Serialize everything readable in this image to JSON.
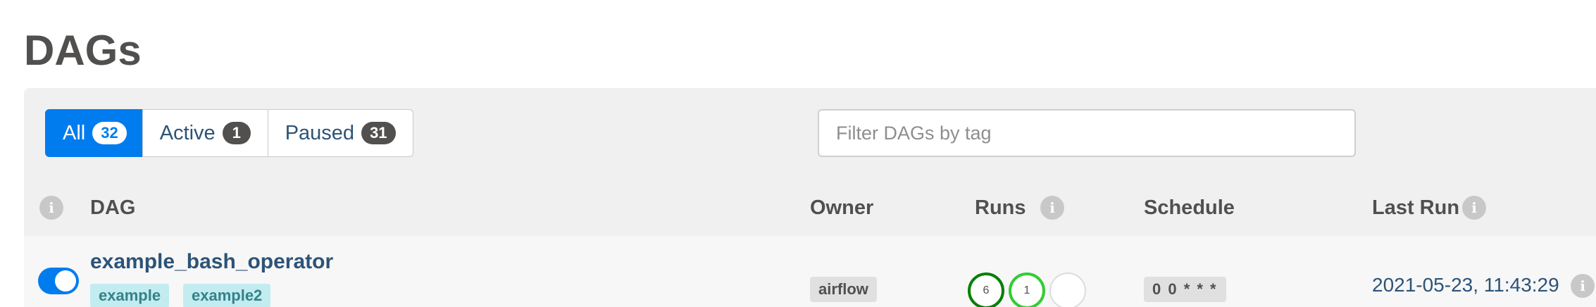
{
  "page": {
    "title": "DAGs"
  },
  "filters": {
    "all": {
      "label": "All",
      "count": "32"
    },
    "active": {
      "label": "Active",
      "count": "1"
    },
    "paused": {
      "label": "Paused",
      "count": "31"
    }
  },
  "tag_filter": {
    "placeholder": "Filter DAGs by tag",
    "value": ""
  },
  "columns": {
    "dag": "DAG",
    "owner": "Owner",
    "runs": "Runs",
    "schedule": "Schedule",
    "last_run": "Last Run"
  },
  "icons": {
    "info": "info-icon",
    "toggle": "toggle-switch"
  },
  "colors": {
    "accent": "#017cee",
    "link": "#2d5377",
    "tag_bg": "#c2ecf0",
    "tag_text": "#35818a",
    "run_success": "#008000",
    "run_running": "#32cd32"
  },
  "dags": [
    {
      "name": "example_bash_operator",
      "active": true,
      "tags": [
        "example",
        "example2"
      ],
      "owner": "airflow",
      "runs": [
        {
          "state": "success",
          "count": "6"
        },
        {
          "state": "running",
          "count": "1"
        },
        {
          "state": "failed",
          "count": ""
        }
      ],
      "schedule": "0 0 * * *",
      "last_run": "2021-05-23, 11:43:29"
    }
  ]
}
